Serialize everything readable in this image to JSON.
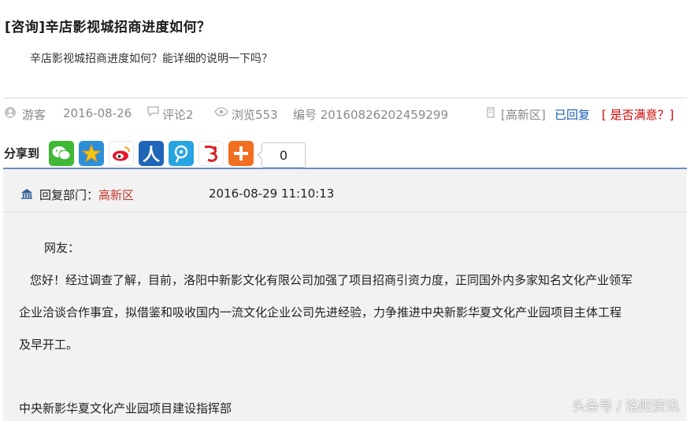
{
  "title": "[咨询]辛店影视城招商进度如何？",
  "question": "辛店影视城招商进度如何？能详细的说明一下吗？",
  "meta": {
    "author": "游客",
    "date": "2016-08-26",
    "comments": "评论2",
    "views": "浏览553",
    "number": "编号 20160826202459299",
    "region": "[高新区]",
    "replied": "已回复",
    "satisfied": "[ 是否满意？]"
  },
  "share": {
    "label": "分享到",
    "count": "0",
    "icons": [
      {
        "name": "wechat-icon",
        "color": "#3fb935"
      },
      {
        "name": "qzone-icon",
        "color": "#2e8fd9"
      },
      {
        "name": "weibo-icon",
        "color": "#e6162d"
      },
      {
        "name": "renren-icon",
        "color": "#1f66b9"
      },
      {
        "name": "tencent-weibo-icon",
        "color": "#28a4e2"
      },
      {
        "name": "kaixin-icon",
        "color": "#d92127"
      },
      {
        "name": "more-icon",
        "color": "#f26f21"
      }
    ]
  },
  "reply": {
    "dept_label": "回复部门：",
    "dept": "高新区",
    "date": "2016-08-29 11:10:13",
    "greeting": "网友：",
    "line1": "您好！经过调查了解，目前，洛阳中新影文化有限公司加强了项目招商引资力度，正同国外内多家知名文化产业领军",
    "line2": "企业洽谈合作事宜，拟借鉴和吸收国内一流文化企业公司先进经验，力争推进中央新影华夏文化产业园项目主体工程",
    "line3": "及早开工。",
    "signature": "中央新影华夏文化产业园项目建设指挥部"
  },
  "watermark": "头条号 / 洛阳资讯"
}
